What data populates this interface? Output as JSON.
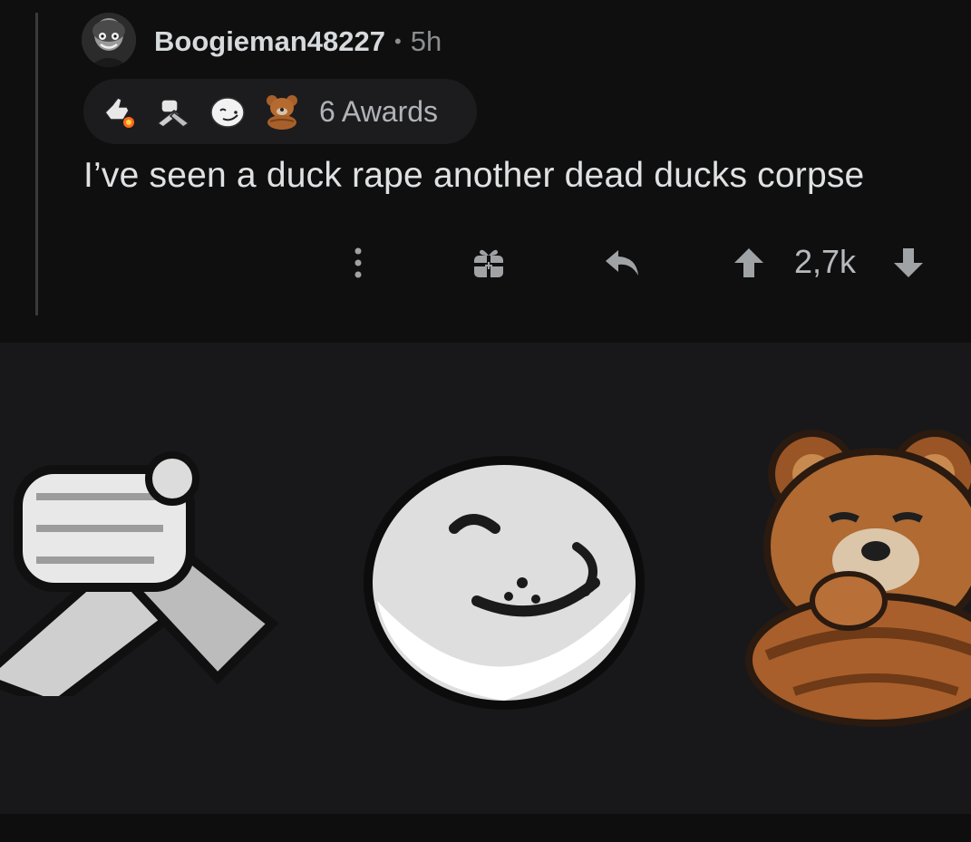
{
  "comment": {
    "username": "Boogieman48227",
    "separator": "•",
    "time": "5h",
    "awards_label": "6 Awards",
    "text": "I’ve seen a duck rape another dead ducks corpse",
    "vote_count": "2,7k",
    "awards": [
      {
        "icon": "rocket-like-award-icon"
      },
      {
        "icon": "handshake-award-icon"
      },
      {
        "icon": "seal-award-icon"
      },
      {
        "icon": "bear-award-icon"
      }
    ]
  },
  "actions": {
    "more_icon": "more-vertical-icon",
    "gift_icon": "gift-icon",
    "reply_icon": "reply-icon",
    "upvote_icon": "upvote-icon",
    "downvote_icon": "downvote-icon"
  },
  "enlarged_awards": [
    {
      "icon": "handshake-award-icon"
    },
    {
      "icon": "seal-award-icon"
    },
    {
      "icon": "bear-award-icon"
    }
  ],
  "colors": {
    "background": "#0f0f10",
    "pill": "#1c1c1e",
    "text": "#dfe1e3",
    "muted": "#8b8d90",
    "bear": "#a8602a"
  }
}
